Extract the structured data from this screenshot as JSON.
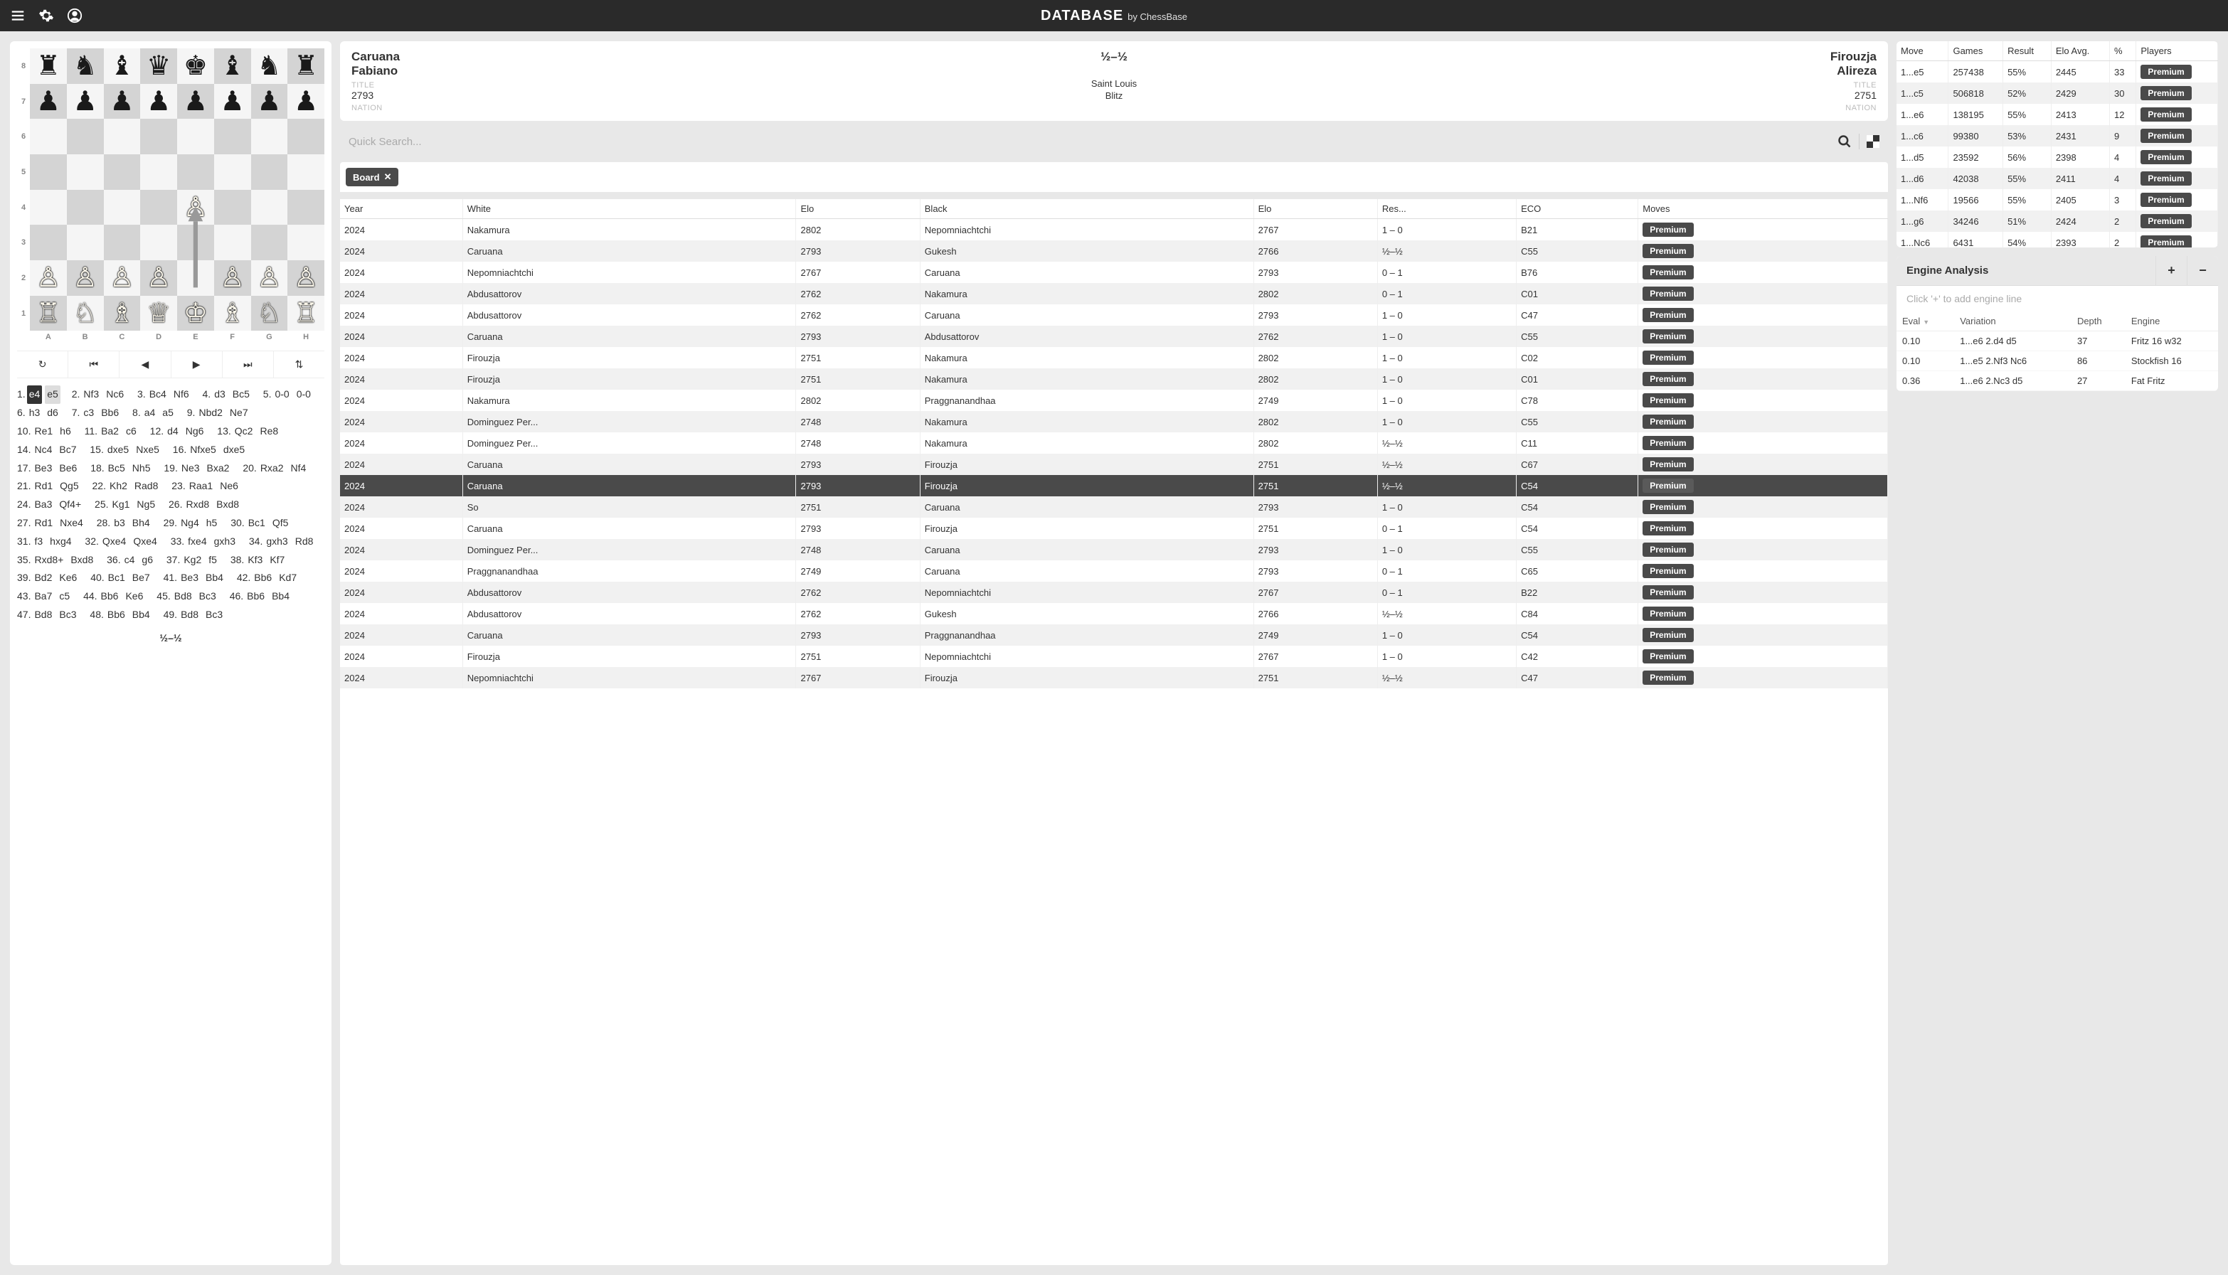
{
  "topbar": {
    "title_db": "DATABASE",
    "title_by": "by ChessBase"
  },
  "gameHeader": {
    "white_last": "Caruana",
    "white_first": "Fabiano",
    "white_elo": "2793",
    "black_last": "Firouzja",
    "black_first": "Alireza",
    "black_elo": "2751",
    "result": "½–½",
    "event": "Saint Louis",
    "type": "Blitz",
    "title_label": "TITLE",
    "nation_label": "NATION"
  },
  "search": {
    "placeholder": "Quick Search..."
  },
  "filterChip": "Board",
  "gamesHeaders": [
    "Year",
    "White",
    "Elo",
    "Black",
    "Elo",
    "Res...",
    "ECO",
    "Moves"
  ],
  "games": [
    {
      "y": "2024",
      "w": "Nakamura",
      "we": "2802",
      "b": "Nepomniachtchi",
      "be": "2767",
      "r": "1 – 0",
      "eco": "B21"
    },
    {
      "y": "2024",
      "w": "Caruana",
      "we": "2793",
      "b": "Gukesh",
      "be": "2766",
      "r": "½–½",
      "eco": "C55"
    },
    {
      "y": "2024",
      "w": "Nepomniachtchi",
      "we": "2767",
      "b": "Caruana",
      "be": "2793",
      "r": "0 – 1",
      "eco": "B76"
    },
    {
      "y": "2024",
      "w": "Abdusattorov",
      "we": "2762",
      "b": "Nakamura",
      "be": "2802",
      "r": "0 – 1",
      "eco": "C01"
    },
    {
      "y": "2024",
      "w": "Abdusattorov",
      "we": "2762",
      "b": "Caruana",
      "be": "2793",
      "r": "1 – 0",
      "eco": "C47"
    },
    {
      "y": "2024",
      "w": "Caruana",
      "we": "2793",
      "b": "Abdusattorov",
      "be": "2762",
      "r": "1 – 0",
      "eco": "C55"
    },
    {
      "y": "2024",
      "w": "Firouzja",
      "we": "2751",
      "b": "Nakamura",
      "be": "2802",
      "r": "1 – 0",
      "eco": "C02"
    },
    {
      "y": "2024",
      "w": "Firouzja",
      "we": "2751",
      "b": "Nakamura",
      "be": "2802",
      "r": "1 – 0",
      "eco": "C01"
    },
    {
      "y": "2024",
      "w": "Nakamura",
      "we": "2802",
      "b": "Praggnanandhaa",
      "be": "2749",
      "r": "1 – 0",
      "eco": "C78"
    },
    {
      "y": "2024",
      "w": "Dominguez Per...",
      "we": "2748",
      "b": "Nakamura",
      "be": "2802",
      "r": "1 – 0",
      "eco": "C55"
    },
    {
      "y": "2024",
      "w": "Dominguez Per...",
      "we": "2748",
      "b": "Nakamura",
      "be": "2802",
      "r": "½–½",
      "eco": "C11"
    },
    {
      "y": "2024",
      "w": "Caruana",
      "we": "2793",
      "b": "Firouzja",
      "be": "2751",
      "r": "½–½",
      "eco": "C67"
    },
    {
      "y": "2024",
      "w": "Caruana",
      "we": "2793",
      "b": "Firouzja",
      "be": "2751",
      "r": "½–½",
      "eco": "C54",
      "sel": true
    },
    {
      "y": "2024",
      "w": "So",
      "we": "2751",
      "b": "Caruana",
      "be": "2793",
      "r": "1 – 0",
      "eco": "C54"
    },
    {
      "y": "2024",
      "w": "Caruana",
      "we": "2793",
      "b": "Firouzja",
      "be": "2751",
      "r": "0 – 1",
      "eco": "C54"
    },
    {
      "y": "2024",
      "w": "Dominguez Per...",
      "we": "2748",
      "b": "Caruana",
      "be": "2793",
      "r": "1 – 0",
      "eco": "C55"
    },
    {
      "y": "2024",
      "w": "Praggnanandhaa",
      "we": "2749",
      "b": "Caruana",
      "be": "2793",
      "r": "0 – 1",
      "eco": "C65"
    },
    {
      "y": "2024",
      "w": "Abdusattorov",
      "we": "2762",
      "b": "Nepomniachtchi",
      "be": "2767",
      "r": "0 – 1",
      "eco": "B22"
    },
    {
      "y": "2024",
      "w": "Abdusattorov",
      "we": "2762",
      "b": "Gukesh",
      "be": "2766",
      "r": "½–½",
      "eco": "C84"
    },
    {
      "y": "2024",
      "w": "Caruana",
      "we": "2793",
      "b": "Praggnanandhaa",
      "be": "2749",
      "r": "1 – 0",
      "eco": "C54"
    },
    {
      "y": "2024",
      "w": "Firouzja",
      "we": "2751",
      "b": "Nepomniachtchi",
      "be": "2767",
      "r": "1 – 0",
      "eco": "C42"
    },
    {
      "y": "2024",
      "w": "Nepomniachtchi",
      "we": "2767",
      "b": "Firouzja",
      "be": "2751",
      "r": "½–½",
      "eco": "C47"
    }
  ],
  "premiumLabel": "Premium",
  "moveHeaders": [
    "Move",
    "Games",
    "Result",
    "Elo Avg.",
    "%",
    "Players"
  ],
  "moveStats": [
    {
      "m": "1...e5",
      "g": "257438",
      "r": "55%",
      "e": "2445",
      "p": "33"
    },
    {
      "m": "1...c5",
      "g": "506818",
      "r": "52%",
      "e": "2429",
      "p": "30"
    },
    {
      "m": "1...e6",
      "g": "138195",
      "r": "55%",
      "e": "2413",
      "p": "12"
    },
    {
      "m": "1...c6",
      "g": "99380",
      "r": "53%",
      "e": "2431",
      "p": "9"
    },
    {
      "m": "1...d5",
      "g": "23592",
      "r": "56%",
      "e": "2398",
      "p": "4"
    },
    {
      "m": "1...d6",
      "g": "42038",
      "r": "55%",
      "e": "2411",
      "p": "4"
    },
    {
      "m": "1...Nf6",
      "g": "19566",
      "r": "55%",
      "e": "2405",
      "p": "3"
    },
    {
      "m": "1...g6",
      "g": "34246",
      "r": "51%",
      "e": "2424",
      "p": "2"
    },
    {
      "m": "1...Nc6",
      "g": "6431",
      "r": "54%",
      "e": "2393",
      "p": "2"
    }
  ],
  "engine": {
    "title": "Engine Analysis",
    "placeholder": "Click '+' to add engine line",
    "headers": [
      "Eval",
      "Variation",
      "Depth",
      "Engine"
    ],
    "lines": [
      {
        "ev": "0.10",
        "v": "1...e6 2.d4 d5",
        "d": "37",
        "en": "Fritz 16 w32"
      },
      {
        "ev": "0.10",
        "v": "1...e5 2.Nf3 Nc6",
        "d": "86",
        "en": "Stockfish 16"
      },
      {
        "ev": "0.36",
        "v": "1...e6 2.Nc3 d5",
        "d": "27",
        "en": "Fat Fritz"
      }
    ]
  },
  "notation": {
    "moves": [
      [
        "1.",
        "e4",
        "e5"
      ],
      [
        "2.",
        "Nf3",
        "Nc6"
      ],
      [
        "3.",
        "Bc4",
        "Nf6"
      ],
      [
        "4.",
        "d3",
        "Bc5"
      ],
      [
        "5.",
        "0-0",
        "0-0"
      ],
      [
        "6.",
        "h3",
        "d6"
      ],
      [
        "7.",
        "c3",
        "Bb6"
      ],
      [
        "8.",
        "a4",
        "a5"
      ],
      [
        "9.",
        "Nbd2",
        "Ne7"
      ],
      [
        "10.",
        "Re1",
        "h6"
      ],
      [
        "11.",
        "Ba2",
        "c6"
      ],
      [
        "12.",
        "d4",
        "Ng6"
      ],
      [
        "13.",
        "Qc2",
        "Re8"
      ],
      [
        "14.",
        "Nc4",
        "Bc7"
      ],
      [
        "15.",
        "dxe5",
        "Nxe5"
      ],
      [
        "16.",
        "Nfxe5",
        "dxe5"
      ],
      [
        "17.",
        "Be3",
        "Be6"
      ],
      [
        "18.",
        "Bc5",
        "Nh5"
      ],
      [
        "19.",
        "Ne3",
        "Bxa2"
      ],
      [
        "20.",
        "Rxa2",
        "Nf4"
      ],
      [
        "21.",
        "Rd1",
        "Qg5"
      ],
      [
        "22.",
        "Kh2",
        "Rad8"
      ],
      [
        "23.",
        "Raa1",
        "Ne6"
      ],
      [
        "24.",
        "Ba3",
        "Qf4+"
      ],
      [
        "25.",
        "Kg1",
        "Ng5"
      ],
      [
        "26.",
        "Rxd8",
        "Bxd8"
      ],
      [
        "27.",
        "Rd1",
        "Nxe4"
      ],
      [
        "28.",
        "b3",
        "Bh4"
      ],
      [
        "29.",
        "Ng4",
        "h5"
      ],
      [
        "30.",
        "Bc1",
        "Qf5"
      ],
      [
        "31.",
        "f3",
        "hxg4"
      ],
      [
        "32.",
        "Qxe4",
        "Qxe4"
      ],
      [
        "33.",
        "fxe4",
        "gxh3"
      ],
      [
        "34.",
        "gxh3",
        "Rd8"
      ],
      [
        "35.",
        "Rxd8+",
        "Bxd8"
      ],
      [
        "36.",
        "c4",
        "g6"
      ],
      [
        "37.",
        "Kg2",
        "f5"
      ],
      [
        "38.",
        "Kf3",
        "Kf7"
      ],
      [
        "39.",
        "Bd2",
        "Ke6"
      ],
      [
        "40.",
        "Bc1",
        "Be7"
      ],
      [
        "41.",
        "Be3",
        "Bb4"
      ],
      [
        "42.",
        "Bb6",
        "Kd7"
      ],
      [
        "43.",
        "Ba7",
        "c5"
      ],
      [
        "44.",
        "Bb6",
        "Ke6"
      ],
      [
        "45.",
        "Bd8",
        "Bc3"
      ],
      [
        "46.",
        "Bb6",
        "Bb4"
      ],
      [
        "47.",
        "Bd8",
        "Bc3"
      ],
      [
        "48.",
        "Bb6",
        "Bb4"
      ],
      [
        "49.",
        "Bd8",
        "Bc3"
      ]
    ],
    "result": "½–½"
  },
  "board": {
    "ranks": [
      "8",
      "7",
      "6",
      "5",
      "4",
      "3",
      "2",
      "1"
    ],
    "files": [
      "A",
      "B",
      "C",
      "D",
      "E",
      "F",
      "G",
      "H"
    ],
    "position": [
      [
        "r",
        "n",
        "b",
        "q",
        "k",
        "b",
        "n",
        "r"
      ],
      [
        "p",
        "p",
        "p",
        "p",
        "p",
        "p",
        "p",
        "p"
      ],
      [
        "",
        "",
        "",
        "",
        "",
        "",
        "",
        ""
      ],
      [
        "",
        "",
        "",
        "",
        "",
        "",
        "",
        ""
      ],
      [
        "",
        "",
        "",
        "",
        "P",
        "",
        "",
        ""
      ],
      [
        "",
        "",
        "",
        "",
        "",
        "",
        "",
        ""
      ],
      [
        "P",
        "P",
        "P",
        "P",
        "",
        "P",
        "P",
        "P"
      ],
      [
        "R",
        "N",
        "B",
        "Q",
        "K",
        "B",
        "N",
        "R"
      ]
    ]
  }
}
